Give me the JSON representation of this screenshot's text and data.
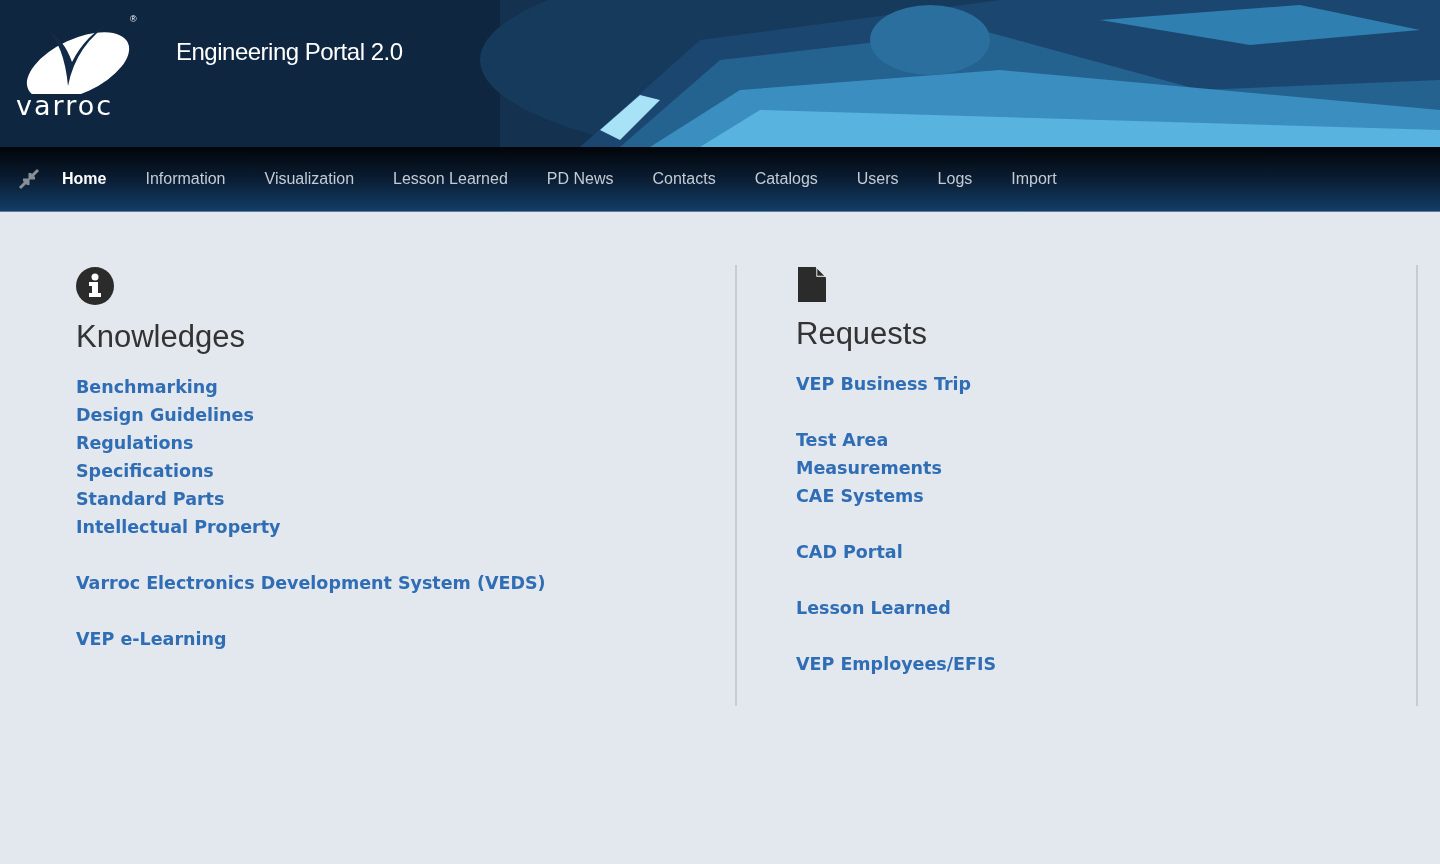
{
  "header": {
    "logo_text": "varroc",
    "registered_mark": "®",
    "title": "Engineering Portal 2.0"
  },
  "nav": {
    "items": [
      {
        "label": "Home",
        "selected": true
      },
      {
        "label": "Information",
        "selected": false
      },
      {
        "label": "Visualization",
        "selected": false
      },
      {
        "label": "Lesson Learned",
        "selected": false
      },
      {
        "label": "PD News",
        "selected": false
      },
      {
        "label": "Contacts",
        "selected": false
      },
      {
        "label": "Catalogs",
        "selected": false
      },
      {
        "label": "Users",
        "selected": false
      },
      {
        "label": "Logs",
        "selected": false
      },
      {
        "label": "Import",
        "selected": false
      }
    ]
  },
  "sections": [
    {
      "kind": "info",
      "heading": "Knowledges",
      "link_groups": [
        [
          "Benchmarking",
          "Design Guidelines",
          "Regulations",
          "Specifications",
          "Standard Parts",
          "Intellectual Property"
        ],
        [
          "Varroc Electronics Development System (VEDS)"
        ],
        [
          "VEP e-Learning"
        ]
      ]
    },
    {
      "kind": "document",
      "heading": "Requests",
      "link_groups": [
        [
          "VEP Business Trip"
        ],
        [
          "Test Area",
          "Measurements",
          "CAE Systems"
        ],
        [
          "CAD Portal"
        ],
        [
          "Lesson Learned"
        ],
        [
          "VEP Employees/EFIS"
        ]
      ]
    }
  ]
}
